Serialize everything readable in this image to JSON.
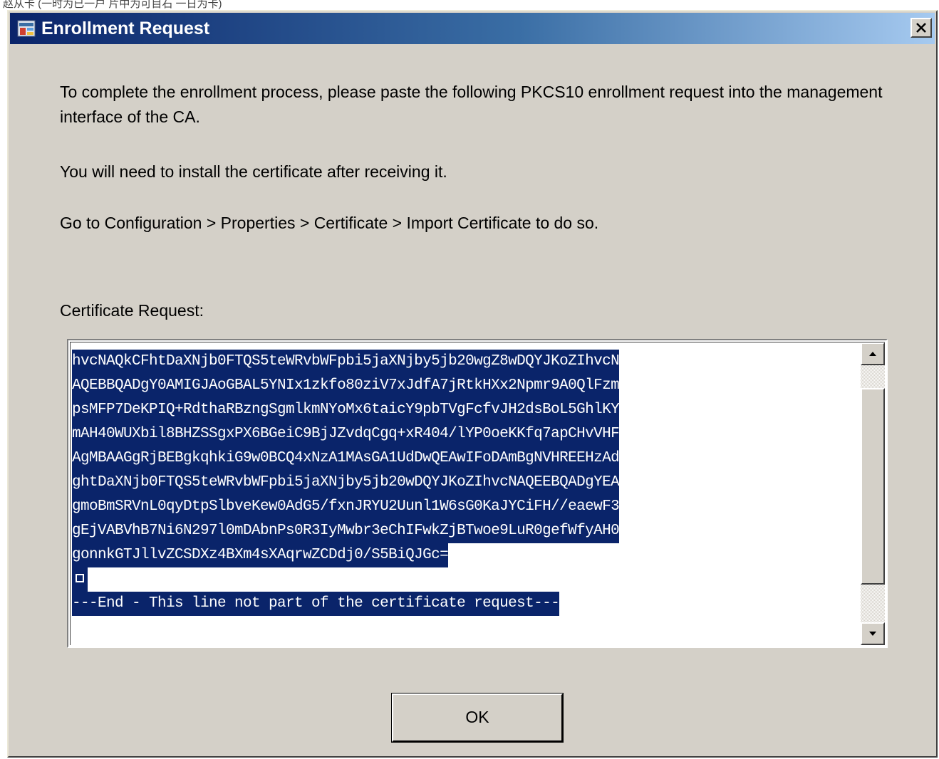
{
  "dialog": {
    "title": "Enrollment Request",
    "title_icon": "app-icon",
    "close_label": "X"
  },
  "message": {
    "line1": "To complete the enrollment process, please paste the following PKCS10 enrollment request into the management interface of the CA.",
    "line2": "You will need to install the certificate after receiving it.",
    "line3": "Go to Configuration > Properties > Certificate > Import Certificate to do so."
  },
  "certificate": {
    "label": "Certificate Request:",
    "lines": [
      "hvcNAQkCFhtDaXNjb0FTQS5teWRvbWFpbi5jaXNjby5jb20wgZ8wDQYJKoZIhvcN",
      "AQEBBQADgY0AMIGJAoGBAL5YNIx1zkfo80ziV7xJdfA7jRtkHXx2Npmr9A0QlFzm",
      "psMFP7DeKPIQ+RdthaRBzngSgmlkmNYoMx6taicY9pbTVgFcfvJH2dsBoL5GhlKY",
      "mAH40WUXbil8BHZSSgxPX6BGeiC9BjJZvdqCgq+xR404/lYP0oeKKfq7apCHvVHF",
      "AgMBAAGgRjBEBgkqhkiG9w0BCQ4xNzA1MAsGA1UdDwQEAwIFoDAmBgNVHREEHzAd",
      "ghtDaXNjb0FTQS5teWRvbWFpbi5jaXNjby5jb20wDQYJKoZIhvcNAQEEBQADgYEA",
      "gmoBmSRVnL0qyDtpSlbveKew0AdG5/fxnJRYU2Uunl1W6sG0KaJYCiFH//eaewF3",
      "gEjVABVhB7Ni6N297l0mDAbnPs0R3IyMwbr3eChIFwkZjBTwoe9LuR0gefWfyAH0",
      "gonnkGTJllvZCSDXz4BXm4sXAqrwZCDdj0/S5BiQJGc="
    ],
    "end_line": "---End - This line not part of the certificate request---"
  },
  "buttons": {
    "ok_label": "OK"
  },
  "colors": {
    "selection": "#0a246a",
    "dialog_bg": "#d4d0c8"
  }
}
